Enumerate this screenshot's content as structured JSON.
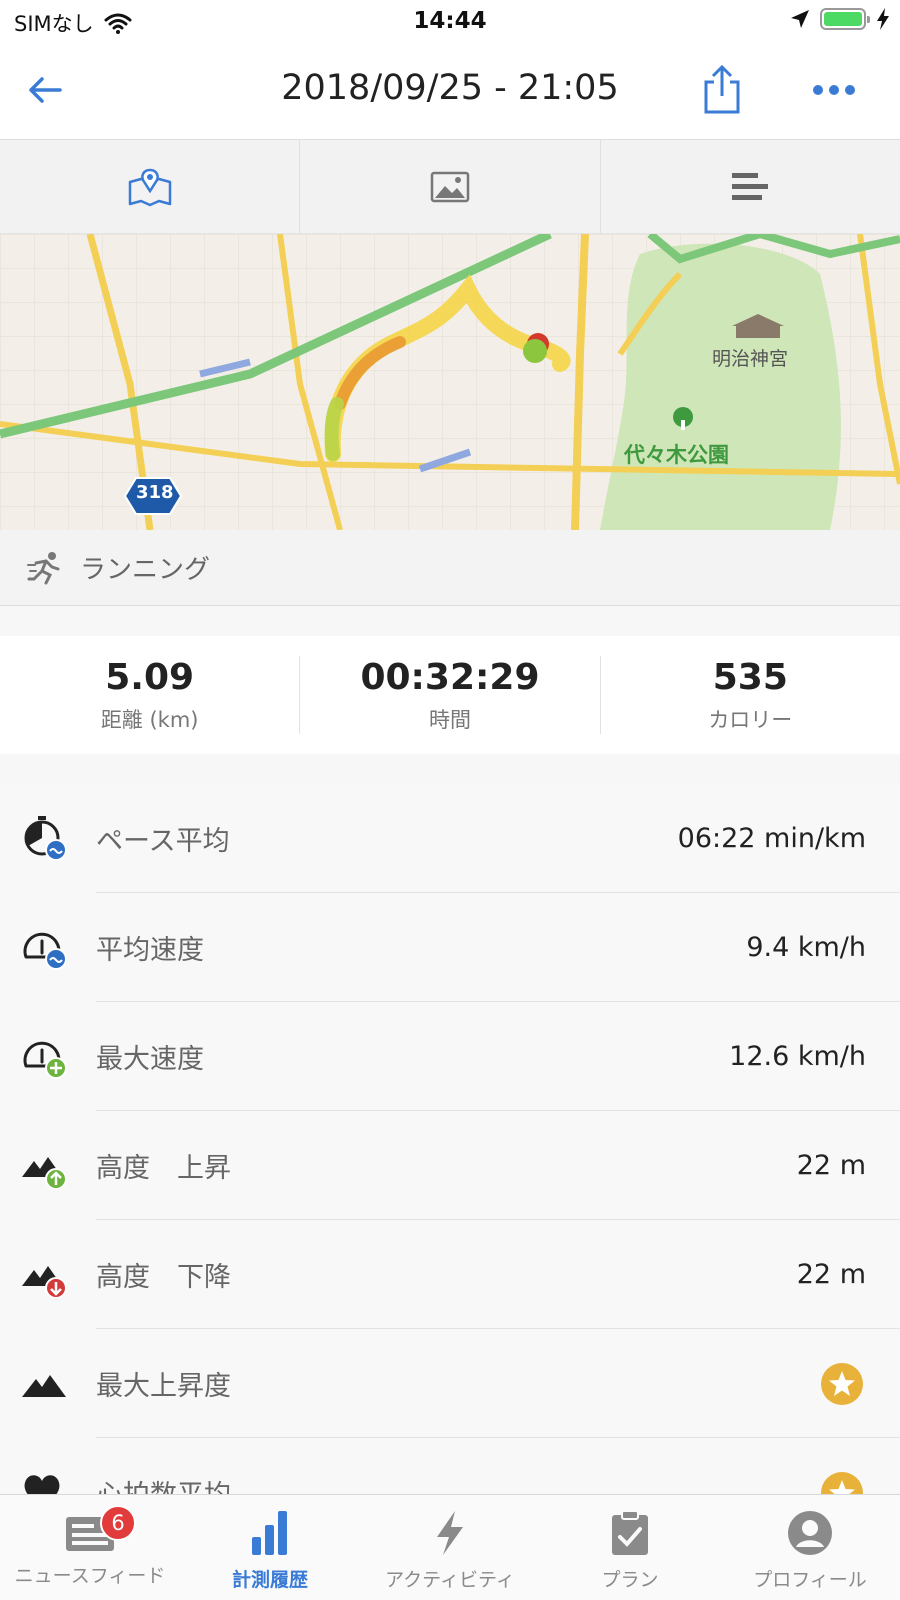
{
  "status_bar": {
    "carrier": "SIMなし",
    "time": "14:44"
  },
  "nav": {
    "title": "2018/09/25 - 21:05"
  },
  "map": {
    "labels": {
      "shrine": "明治神宮",
      "park": "代々木公園",
      "route": "318"
    }
  },
  "activity": {
    "type_label": "ランニング"
  },
  "summary": [
    {
      "value": "5.09",
      "label": "距離 (km)"
    },
    {
      "value": "00:32:29",
      "label": "時間"
    },
    {
      "value": "535",
      "label": "カロリー"
    }
  ],
  "metrics": [
    {
      "label": "ペース平均",
      "value": "06:22 min/km",
      "icon": "pace-average-icon"
    },
    {
      "label": "平均速度",
      "value": "9.4 km/h",
      "icon": "average-speed-icon"
    },
    {
      "label": "最大速度",
      "value": "12.6 km/h",
      "icon": "max-speed-icon"
    },
    {
      "label": "高度　上昇",
      "value": "22 m",
      "icon": "elevation-gain-icon"
    },
    {
      "label": "高度　下降",
      "value": "22 m",
      "icon": "elevation-loss-icon"
    },
    {
      "label": "最大上昇度",
      "value": "",
      "icon": "max-elevation-icon"
    },
    {
      "label": "心拍数平均",
      "value": "",
      "icon": "heart-rate-icon"
    }
  ],
  "tabbar": [
    {
      "label": "ニュースフィード",
      "badge": "6"
    },
    {
      "label": "計測履歴"
    },
    {
      "label": "アクティビティ"
    },
    {
      "label": "プラン"
    },
    {
      "label": "プロフィール"
    }
  ],
  "colors": {
    "accent": "#3a7bd5",
    "badge": "#e23b3b",
    "star": "#e8b23a",
    "park_green": "#3f9a3f"
  }
}
